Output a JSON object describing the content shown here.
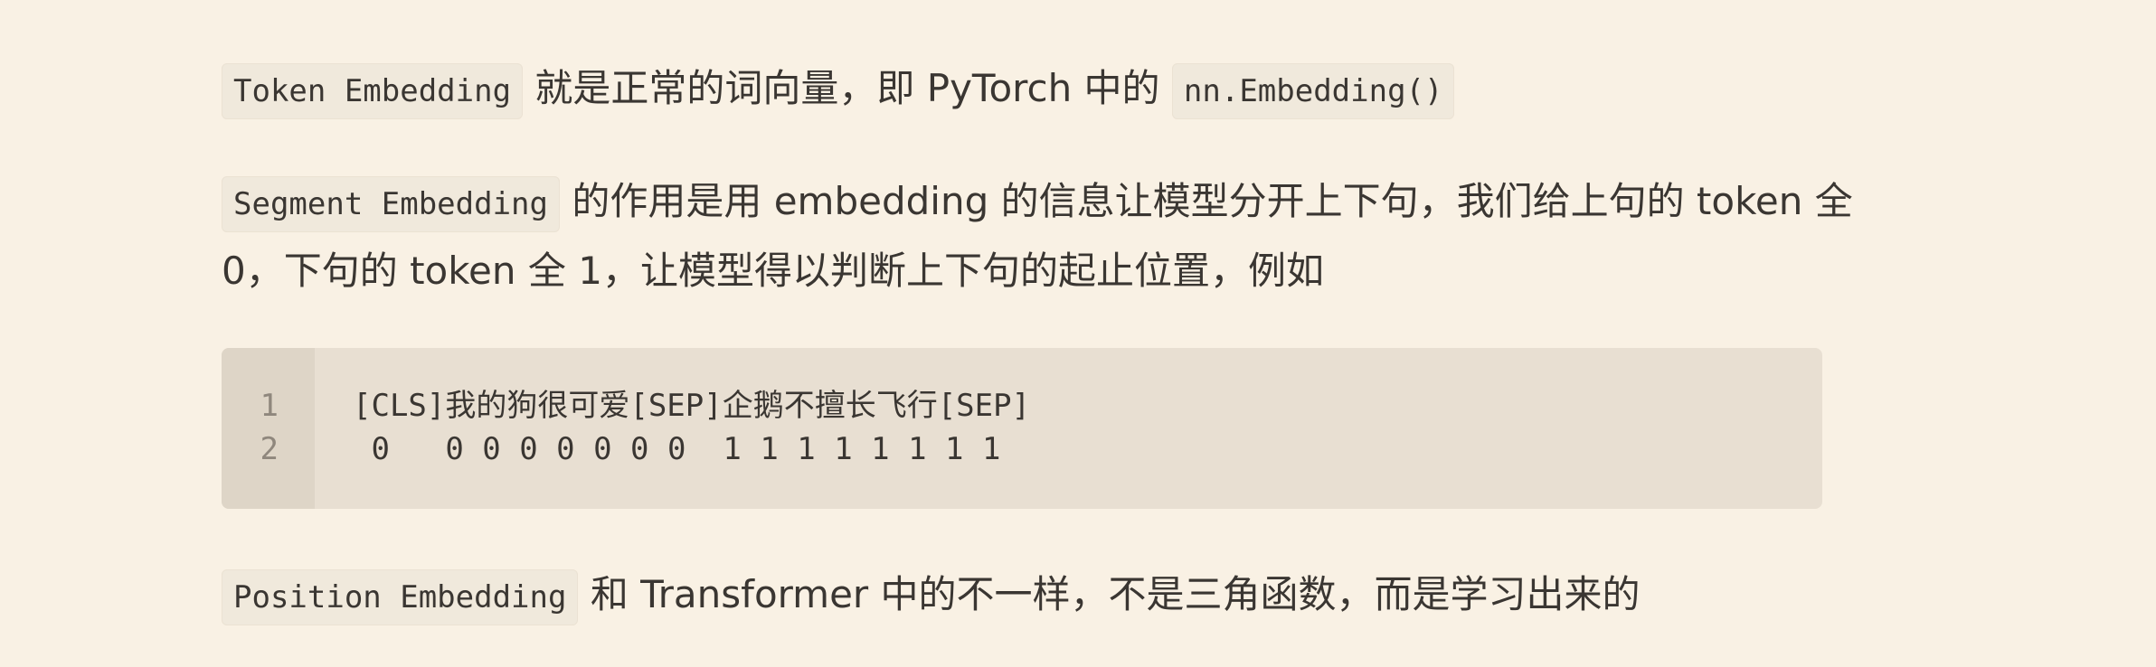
{
  "paragraphs": {
    "p1": {
      "code1": "Token Embedding",
      "text1": " 就是正常的词向量，即 PyTorch 中的 ",
      "code2": "nn.Embedding()"
    },
    "p2": {
      "code1": "Segment Embedding",
      "text1_line1": " 的作用是用 embedding 的信息让模型分开上下句，我们给上句的 token 全",
      "text1_line2": "0，下句的 token 全 1，让模型得以判断上下句的起止位置，例如"
    },
    "p3": {
      "code1": "Position Embedding",
      "text1": " 和 Transformer 中的不一样，不是三角函数，而是学习出来的"
    }
  },
  "codeblock": {
    "line_numbers": [
      "1",
      "2"
    ],
    "lines": [
      "[CLS]我的狗很可爱[SEP]企鹅不擅长飞行[SEP]",
      " 0   0 0 0 0 0 0 0  1 1 1 1 1 1 1 1"
    ]
  }
}
